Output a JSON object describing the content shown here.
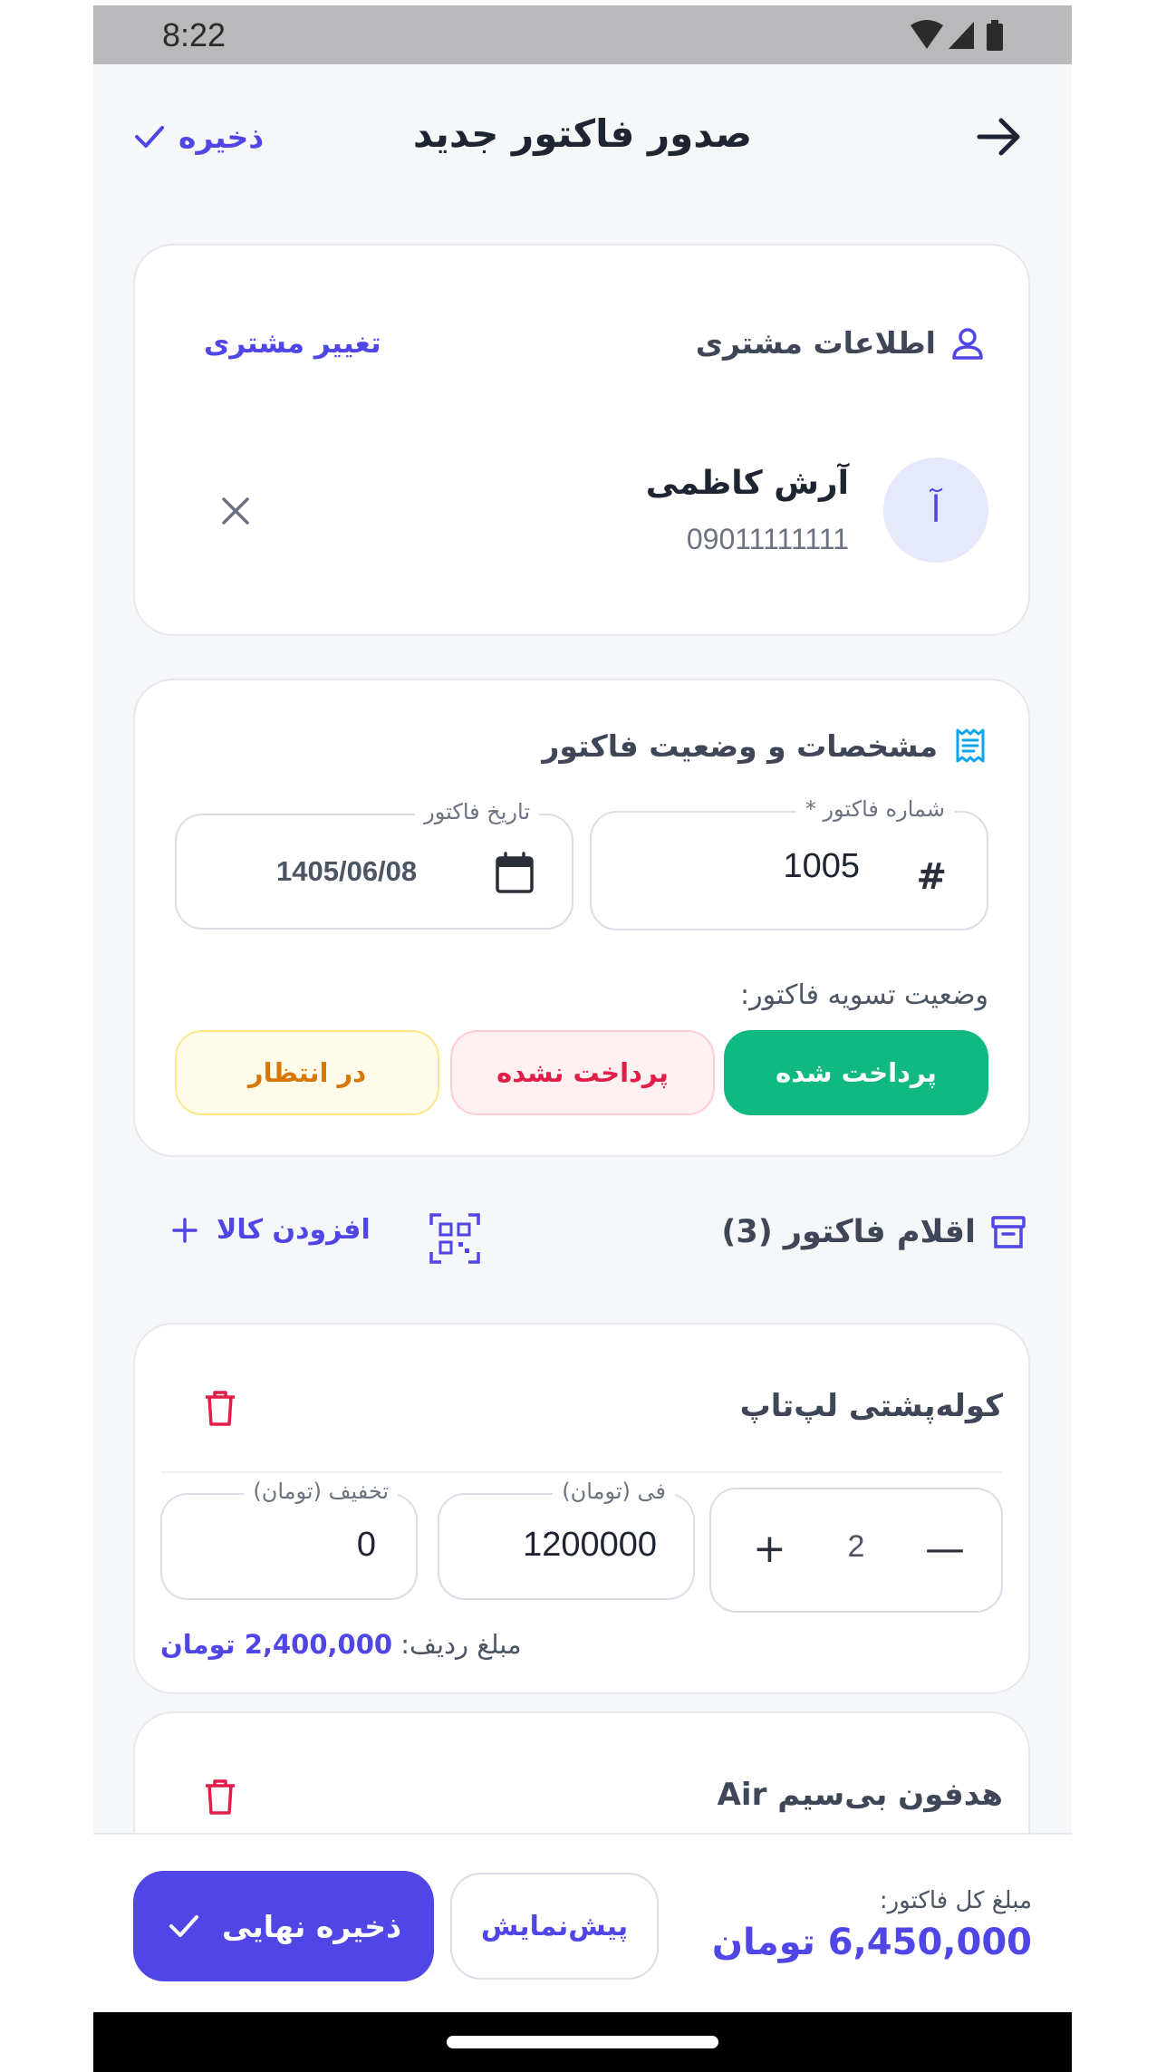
{
  "status_bar": {
    "time": "8:22"
  },
  "header": {
    "title": "صدور فاکتور جدید",
    "save_label": "ذخیره"
  },
  "customer": {
    "section_title": "اطلاعات مشتری",
    "change_label": "تغییر مشتری",
    "avatar_letter": "آ",
    "name": "آرش کاظمی",
    "phone": "09011111111"
  },
  "invoice_spec": {
    "section_title": "مشخصات و وضعیت فاکتور",
    "number_label": "شماره فاکتور *",
    "number_value": "1005",
    "date_label": "تاریخ فاکتور",
    "date_value": "1405/06/08",
    "settlement_label": "وضعیت تسویه فاکتور:",
    "statuses": {
      "paid": "پرداخت شده",
      "unpaid": "پرداخت نشده",
      "pending": "در انتظار"
    },
    "selected_status": "paid"
  },
  "items_section": {
    "title": "اقلام فاکتور (3)",
    "add_label": "افزودن کالا"
  },
  "items": [
    {
      "name": "کوله‌پشتی لپ‌تاپ",
      "quantity": "2",
      "price_label": "فی (تومان)",
      "price": "1200000",
      "discount_label": "تخفیف (تومان)",
      "discount": "0",
      "row_total_label": "مبلغ ردیف:",
      "row_total": "2,400,000 تومان"
    },
    {
      "name": "هدفون بی‌سیم Air"
    }
  ],
  "footer": {
    "total_label": "مبلغ کل فاکتور:",
    "total_value": "6,450,000 تومان",
    "preview_label": "پیش‌نمایش",
    "final_save_label": "ذخیره نهایی"
  },
  "colors": {
    "accent": "#4f46e5",
    "paid": "#10b981",
    "unpaid": "#e11d48",
    "pending": "#d97706",
    "danger": "#e11d48"
  }
}
